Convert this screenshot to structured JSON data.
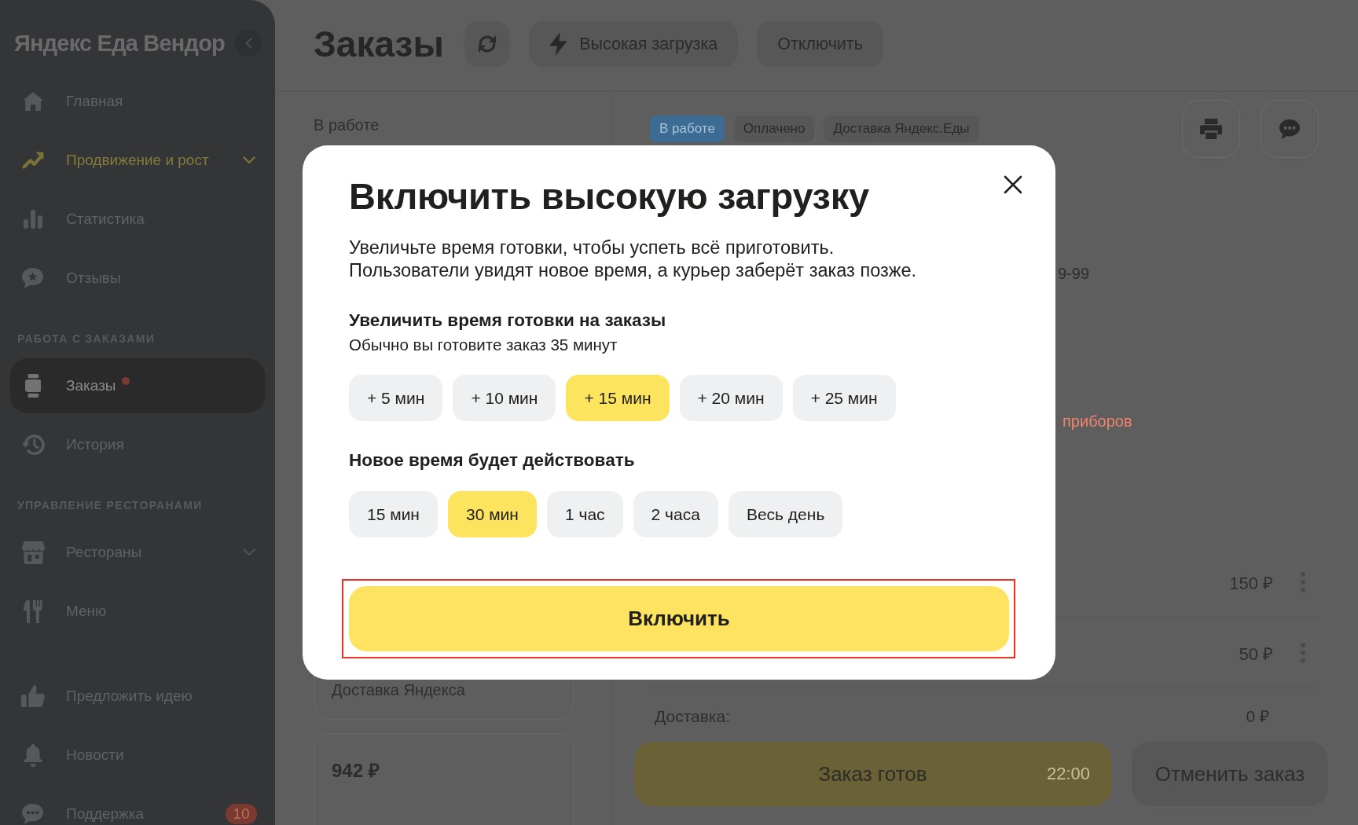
{
  "sidebar": {
    "logo": "Яндекс Еда Вендор",
    "groups": [
      {
        "items": [
          {
            "label": "Главная",
            "kind": "link",
            "selected": false
          },
          {
            "label": "Продвижение и рост",
            "kind": "promo",
            "selected": false,
            "expanded": false
          },
          {
            "label": "Статистика",
            "kind": "link",
            "selected": false
          },
          {
            "label": "Отзывы",
            "kind": "link",
            "selected": false
          }
        ]
      },
      {
        "heading": "РАБОТА С ЗАКАЗАМИ",
        "items": [
          {
            "label": "Заказы",
            "kind": "link",
            "selected": true,
            "dot": true
          },
          {
            "label": "История",
            "kind": "link",
            "selected": false
          }
        ]
      },
      {
        "heading": "УПРАВЛЕНИЕ РЕСТОРАНАМИ",
        "items": [
          {
            "label": "Рестораны",
            "kind": "link",
            "selected": false,
            "expanded": false
          },
          {
            "label": "Меню",
            "kind": "link",
            "selected": false
          }
        ]
      },
      {
        "items": [
          {
            "label": "Предложить идею",
            "kind": "link",
            "selected": false
          },
          {
            "label": "Новости",
            "kind": "link",
            "selected": false
          },
          {
            "label": "Поддержка",
            "kind": "link",
            "selected": false,
            "badge": "10"
          }
        ]
      }
    ]
  },
  "header": {
    "title": "Заказы",
    "actions": [
      {
        "label": "Высокая загрузка"
      },
      {
        "label": "Отключить"
      }
    ]
  },
  "orders": {
    "heading": "В работе",
    "cards": [
      {
        "delivery": "Доставка Яндекса"
      },
      {
        "total": "942 ₽"
      }
    ]
  },
  "order_detail": {
    "tags": [
      {
        "label": "В работе",
        "kind": "status"
      },
      {
        "label": "Оплачено",
        "kind": "plain"
      },
      {
        "label": "Доставка Яндекс.Еды",
        "kind": "plain"
      }
    ],
    "phone": "9-99",
    "note": "приборов",
    "items": [
      {
        "price": "150 ₽"
      },
      {
        "price": "50 ₽"
      }
    ],
    "delivery": {
      "label": "Доставка:",
      "price": "0 ₽"
    },
    "ready_button": {
      "label": "Заказ готов",
      "time": "22:00"
    },
    "cancel_button": {
      "label": "Отменить заказ"
    }
  },
  "modal": {
    "title": "Включить высокую загрузку",
    "description": [
      "Увеличьте время готовки, чтобы успеть всё приготовить.",
      "Пользователи увидят новое время, а курьер заберёт заказ позже."
    ],
    "option_groups": [
      {
        "title": "Увеличить время готовки на заказы",
        "hint": "Обычно вы готовите заказ 35 минут",
        "options": [
          {
            "label": "+ 5 мин",
            "selected": false
          },
          {
            "label": "+ 10 мин",
            "selected": false
          },
          {
            "label": "+ 15 мин",
            "selected": true
          },
          {
            "label": "+ 20 мин",
            "selected": false
          },
          {
            "label": "+ 25 мин",
            "selected": false
          }
        ]
      },
      {
        "title": "Новое время будет действовать",
        "options": [
          {
            "label": "15 мин",
            "selected": false
          },
          {
            "label": "30 мин",
            "selected": true
          },
          {
            "label": "1 час",
            "selected": false
          },
          {
            "label": "2 часа",
            "selected": false
          },
          {
            "label": "Весь день",
            "selected": false
          }
        ]
      }
    ],
    "confirm_button": {
      "label": "Включить",
      "highlighted": true
    }
  }
}
